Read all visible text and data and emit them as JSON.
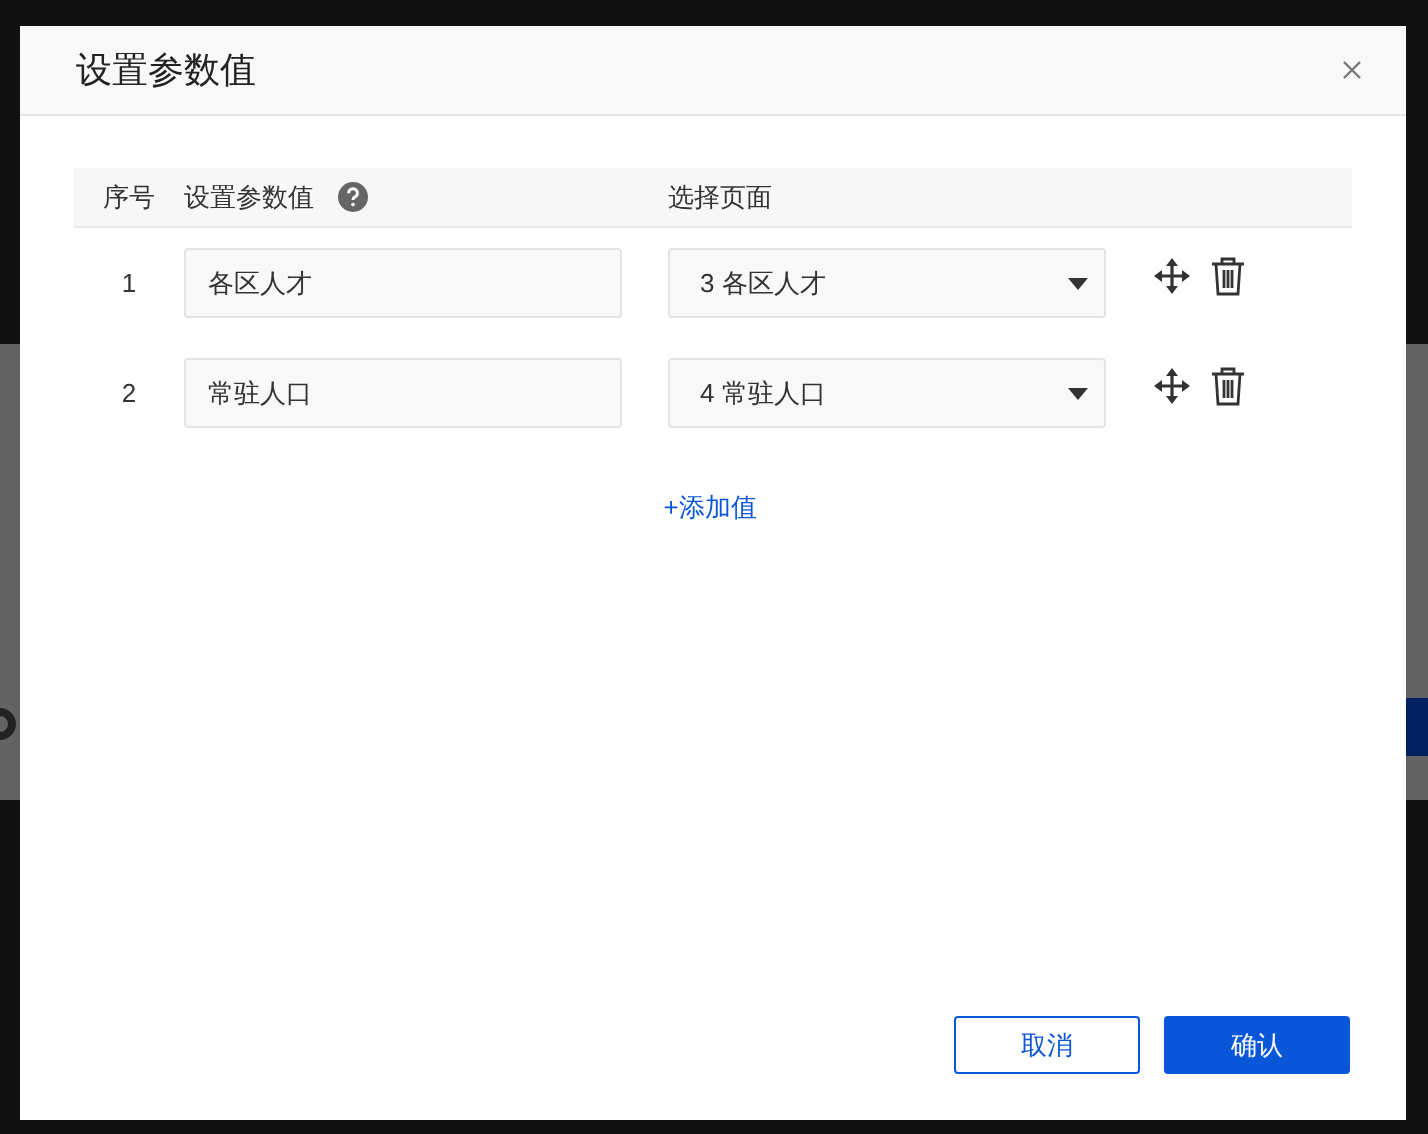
{
  "dialog": {
    "title": "设置参数值",
    "columns": [
      "序号",
      "设置参数值",
      "选择页面"
    ],
    "rows": [
      {
        "index": "1",
        "value": "各区人才",
        "page": "3 各区人才"
      },
      {
        "index": "2",
        "value": "常驻人口",
        "page": "4 常驻人口"
      }
    ],
    "add_link": "+添加值",
    "buttons": [
      {
        "label": "取消",
        "kind": "secondary"
      },
      {
        "label": "确认",
        "kind": "primary"
      }
    ]
  }
}
